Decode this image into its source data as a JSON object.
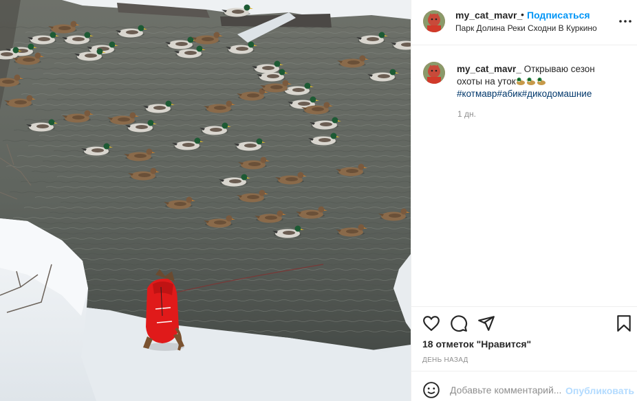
{
  "post": {
    "username": "my_cat_mavr_",
    "separator": "•",
    "follow_label": "Подписаться",
    "location": "Парк Долина Реки Сходни В Куркино"
  },
  "caption": {
    "username": "my_cat_mavr_",
    "text": "Открываю сезон охоты на уток",
    "emoji": [
      "duck",
      "duck",
      "duck"
    ],
    "hashtags": "#котмавр#абик#дикодомашние",
    "time_ago": "1 дн."
  },
  "stats": {
    "likes": "18 отметок \"Нравится\"",
    "date": "ДЕНЬ НАЗАД"
  },
  "comment_box": {
    "placeholder": "Добавьте комментарий...",
    "publish_label": "Опубликовать"
  },
  "icons": {
    "more": "more-horizontal-icon",
    "like": "heart-icon",
    "comment": "comment-icon",
    "share": "share-icon",
    "save": "bookmark-icon",
    "emoji": "smiley-icon"
  },
  "colors": {
    "link": "#0095f6",
    "hashtag": "#00376b",
    "muted": "#8e8e8e",
    "border": "#efefef",
    "publish_disabled": "#b3dbff"
  }
}
